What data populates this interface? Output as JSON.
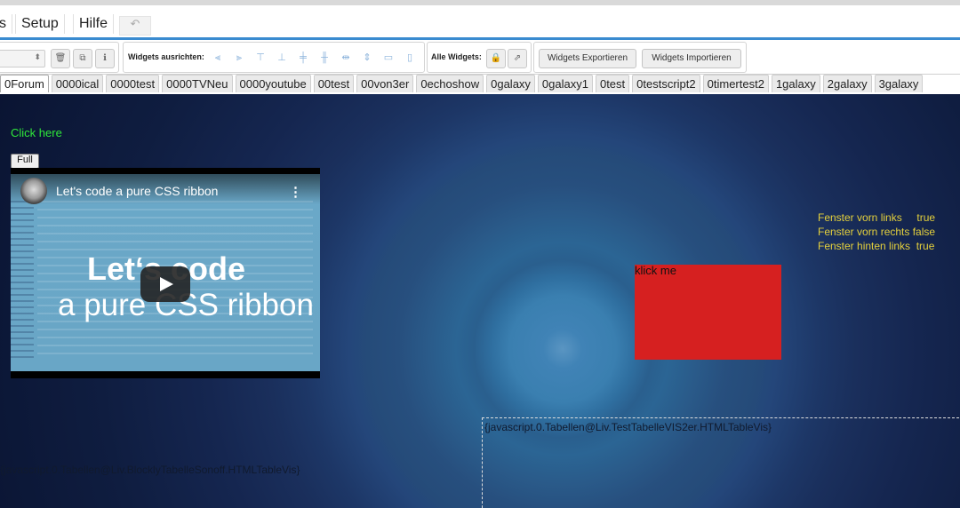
{
  "menu": {
    "items": [
      "s",
      "Setup",
      "Hilfe"
    ],
    "undo_icon": "undo-arrow-icon"
  },
  "toolbar": {
    "select_arrow": "⬍",
    "align_label": "Widgets ausrichten:",
    "all_widgets_label": "Alle Widgets:",
    "export_label": "Widgets Exportieren",
    "import_label": "Widgets Importieren"
  },
  "views": {
    "tabs": [
      "0Forum",
      "0000ical",
      "0000test",
      "0000TVNeu",
      "0000youtube",
      "00test",
      "00von3er",
      "0echoshow",
      "0galaxy",
      "0galaxy1",
      "0test",
      "0testscript2",
      "0timertest2",
      "1galaxy",
      "2galaxy",
      "3galaxy"
    ],
    "active": "0Forum"
  },
  "canvas": {
    "click_here": "Click here",
    "full_button": "Full",
    "video": {
      "title": "Let's code a pure CSS ribbon",
      "thumb_line1": "Let‘s code",
      "thumb_line2": "a pure CSS ribbon"
    },
    "fenster_lines": [
      "Fenster vorn links     true",
      "Fenster vorn rechts false",
      "Fenster hinten links  true"
    ],
    "klick_me": "klick me",
    "table_widget_1": "{javascript.0.Tabellen@Liv.BlocklyTabelleSonoff.HTMLTableVis}",
    "table_widget_2": "{javascript.0.Tabellen@Liv.TestTabelleVIS2er.HTMLTableVis}"
  },
  "colors": {
    "accent": "#3a8bd0",
    "click_here": "#2fe83a",
    "fenster_text": "#e4d03c",
    "red_box": "#d62020"
  }
}
